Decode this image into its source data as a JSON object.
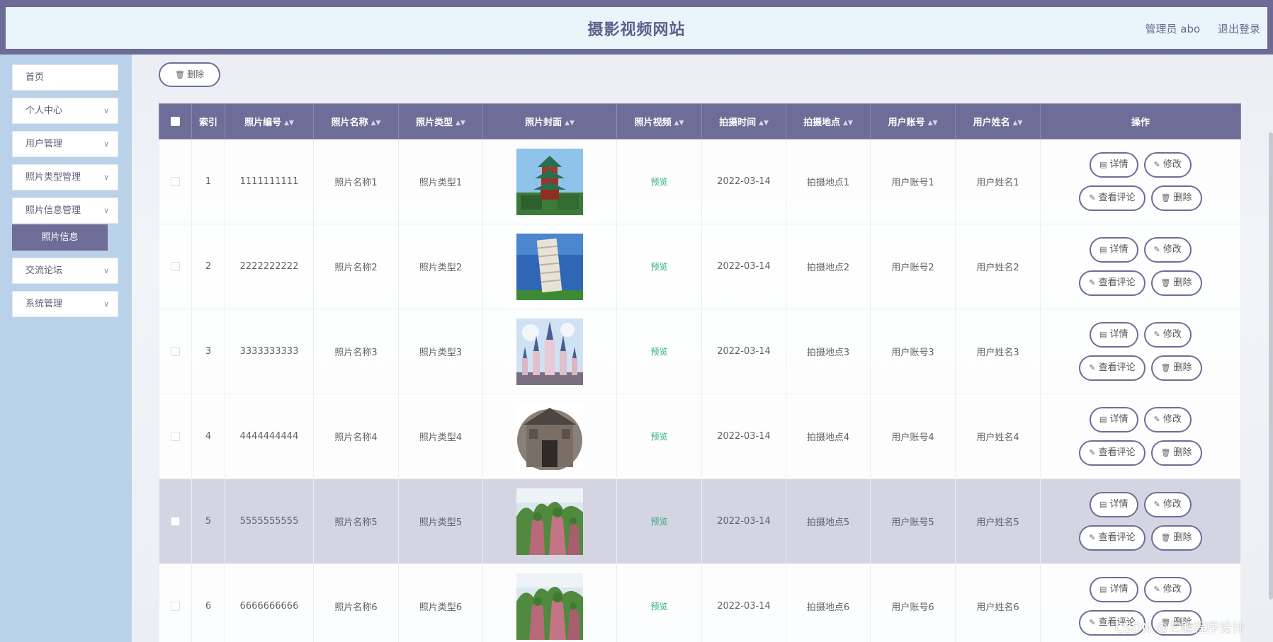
{
  "header": {
    "title": "摄影视频网站",
    "admin": "管理员 abo",
    "logout": "退出登录"
  },
  "sidebar": {
    "items": [
      {
        "label": "首页",
        "has_arrow": false
      },
      {
        "label": "个人中心",
        "has_arrow": true
      },
      {
        "label": "用户管理",
        "has_arrow": true
      },
      {
        "label": "照片类型管理",
        "has_arrow": true
      },
      {
        "label": "照片信息管理",
        "has_arrow": true
      },
      {
        "label": "交流论坛",
        "has_arrow": true
      },
      {
        "label": "系统管理",
        "has_arrow": true
      }
    ],
    "active_sub": "照片信息"
  },
  "toolbar": {
    "delete_label": "删除"
  },
  "table": {
    "headers": {
      "index": "索引",
      "no": "照片编号",
      "name": "照片名称",
      "type": "照片类型",
      "cover": "照片封面",
      "video": "照片视频",
      "time": "拍摄时间",
      "place": "拍摄地点",
      "account": "用户账号",
      "username": "用户姓名",
      "ops": "操作"
    },
    "rows": [
      {
        "index": "1",
        "no": "1111111111",
        "name": "照片名称1",
        "type": "照片类型1",
        "cover": "pagoda",
        "video": "预览",
        "time": "2022-03-14",
        "place": "拍摄地点1",
        "account": "用户账号1",
        "username": "用户姓名1",
        "highlight": false
      },
      {
        "index": "2",
        "no": "2222222222",
        "name": "照片名称2",
        "type": "照片类型2",
        "cover": "tower",
        "video": "预览",
        "time": "2022-03-14",
        "place": "拍摄地点2",
        "account": "用户账号2",
        "username": "用户姓名2",
        "highlight": false
      },
      {
        "index": "3",
        "no": "3333333333",
        "name": "照片名称3",
        "type": "照片类型3",
        "cover": "castle",
        "video": "预览",
        "time": "2022-03-14",
        "place": "拍摄地点3",
        "account": "用户账号3",
        "username": "用户姓名3",
        "highlight": false
      },
      {
        "index": "4",
        "no": "4444444444",
        "name": "照片名称4",
        "type": "照片类型4",
        "cover": "gate",
        "video": "预览",
        "time": "2022-03-14",
        "place": "拍摄地点4",
        "account": "用户账号4",
        "username": "用户姓名4",
        "highlight": false
      },
      {
        "index": "5",
        "no": "5555555555",
        "name": "照片名称5",
        "type": "照片类型5",
        "cover": "mountain",
        "video": "预览",
        "time": "2022-03-14",
        "place": "拍摄地点5",
        "account": "用户账号5",
        "username": "用户姓名5",
        "highlight": true
      },
      {
        "index": "6",
        "no": "6666666666",
        "name": "照片名称6",
        "type": "照片类型6",
        "cover": "mountain",
        "video": "预览",
        "time": "2022-03-14",
        "place": "拍摄地点6",
        "account": "用户账号6",
        "username": "用户姓名6",
        "highlight": false
      }
    ],
    "ops": {
      "detail": "详情",
      "edit": "修改",
      "comments": "查看评论",
      "delete": "删除"
    }
  },
  "watermark": "CSDN @艺赡程序设计",
  "colors": {
    "primary": "#6d6d97",
    "header_bg": "#e9f4fb",
    "sidebar_bg": "#b9d1e9",
    "preview": "#2aae7a",
    "row_highlight": "#d4d4e2"
  }
}
